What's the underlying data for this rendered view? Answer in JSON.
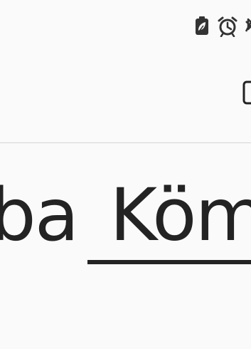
{
  "status_bar": {
    "icons": [
      "battery-saver-icon",
      "alarm-icon",
      "bluetooth-icon"
    ]
  },
  "toolbar": {
    "icons": [
      "square-button-icon"
    ]
  },
  "content": {
    "word_before": "ba",
    "link_word": "Köm"
  },
  "colors": {
    "background": "#fafafa",
    "text": "#232323",
    "icon": "#333333",
    "divider": "#d6d6d6"
  }
}
